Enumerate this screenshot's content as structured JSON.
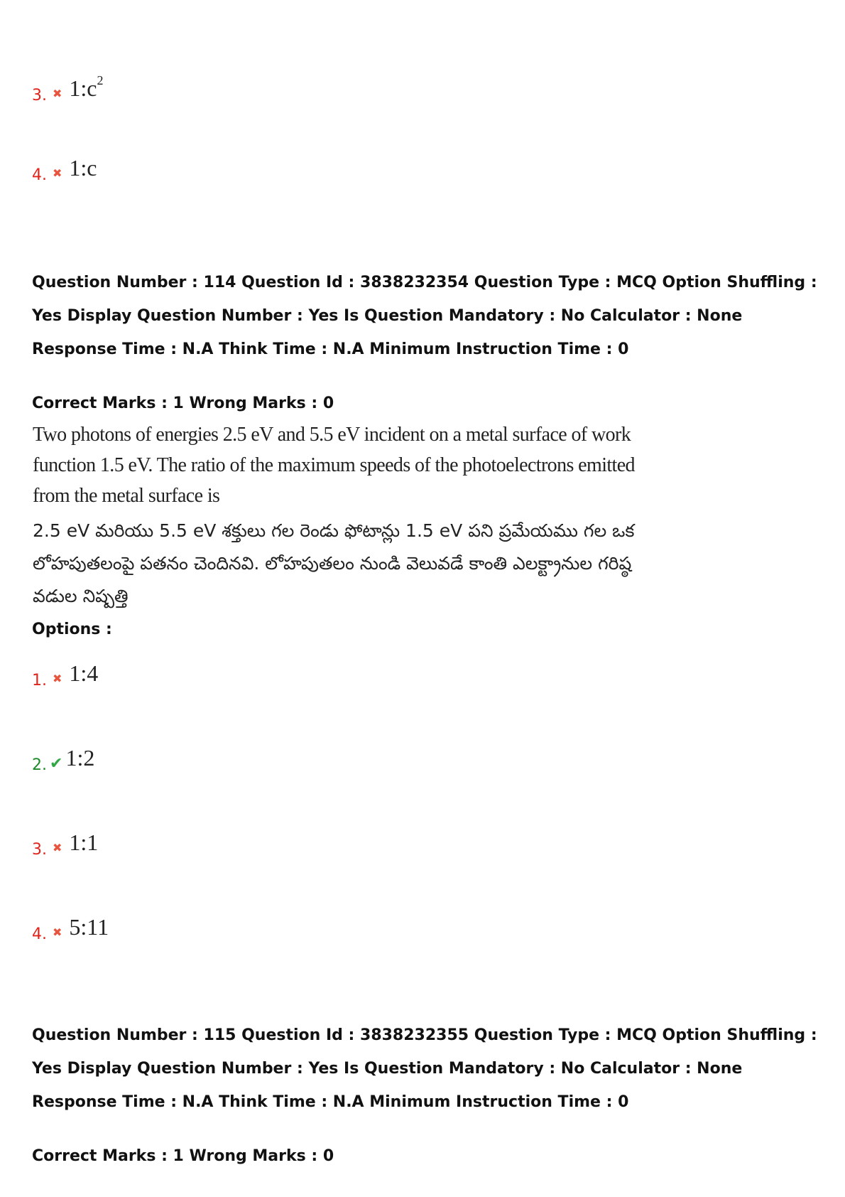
{
  "prev_options": [
    {
      "num": "3.",
      "status": "wrong",
      "mark": "✖",
      "value": "1:c",
      "sup": "2"
    },
    {
      "num": "4.",
      "status": "wrong",
      "mark": "✖",
      "value": "1:c",
      "sup": ""
    }
  ],
  "q114": {
    "meta": "Question Number : 114 Question Id : 3838232354 Question Type : MCQ Option Shuffling : Yes Display Question Number : Yes Is Question Mandatory : No Calculator : None Response Time : N.A Think Time : N.A Minimum Instruction Time : 0",
    "marks": "Correct Marks : 1 Wrong Marks : 0",
    "text_en": "Two photons of energies 2.5 eV and 5.5 eV incident on a metal surface of work function 1.5 eV. The ratio of the maximum speeds of the photoelectrons emitted from the metal surface is",
    "text_te": "2.5 eV మరియు 5.5 eV శక్తులు గల రెండు ఫోటాన్లు 1.5 eV పని ప్రమేయము గల ఒక లోహపుతలంపై పతనం చెందినవి. లోహపుతలం నుండి వెలువడే కాంతి ఎలక్ట్రానుల గరిష్ఠ వడుల నిష్పత్తి",
    "options_label": "Options :",
    "options": [
      {
        "num": "1.",
        "status": "wrong",
        "mark": "✖",
        "value": "1:4"
      },
      {
        "num": "2.",
        "status": "right",
        "mark": "✔",
        "value": "1:2"
      },
      {
        "num": "3.",
        "status": "wrong",
        "mark": "✖",
        "value": "1:1"
      },
      {
        "num": "4.",
        "status": "wrong",
        "mark": "✖",
        "value": "5:11"
      }
    ]
  },
  "q115": {
    "meta": "Question Number : 115 Question Id : 3838232355 Question Type : MCQ Option Shuffling : Yes Display Question Number : Yes Is Question Mandatory : No Calculator : None Response Time : N.A Think Time : N.A Minimum Instruction Time : 0",
    "marks": "Correct Marks : 1 Wrong Marks : 0"
  },
  "colors": {
    "wrong": "#e0241c",
    "right": "#1e8a2c"
  }
}
